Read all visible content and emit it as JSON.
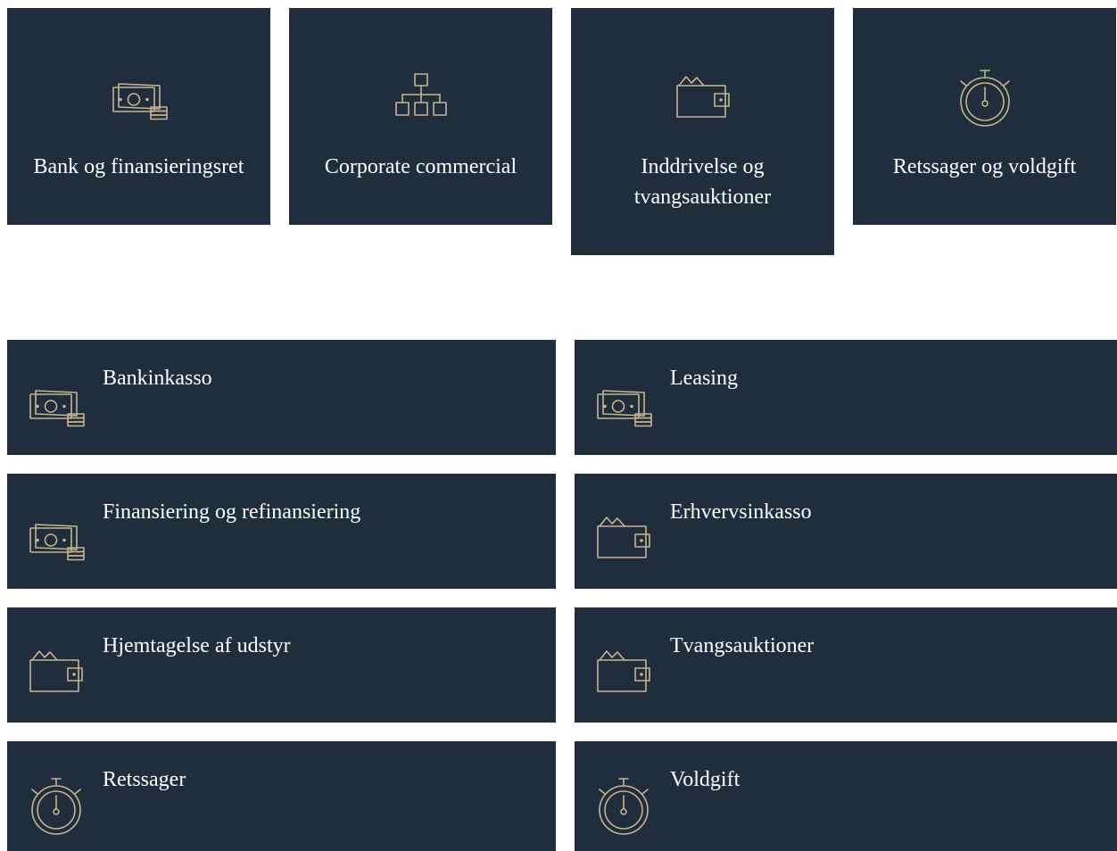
{
  "icons": {
    "color": "#c7b48e",
    "card_background": "#202d3c"
  },
  "top_cards": [
    {
      "label": "Bank og finansieringsret",
      "icon": "money-icon"
    },
    {
      "label": "Corporate commercial",
      "icon": "org-chart-icon"
    },
    {
      "label": "Inddrivelse og tvangsauktioner",
      "icon": "wallet-icon"
    },
    {
      "label": "Retssager og voldgift",
      "icon": "stopwatch-icon"
    }
  ],
  "service_list": [
    {
      "label": "Bankinkasso",
      "icon": "money-icon"
    },
    {
      "label": "Leasing",
      "icon": "money-icon"
    },
    {
      "label": "Finansiering og refinansiering",
      "icon": "money-icon"
    },
    {
      "label": "Erhvervsinkasso",
      "icon": "wallet-icon"
    },
    {
      "label": "Hjemtagelse af udstyr",
      "icon": "wallet-icon"
    },
    {
      "label": "Tvangsauktioner",
      "icon": "wallet-icon"
    },
    {
      "label": "Retssager",
      "icon": "stopwatch-icon"
    },
    {
      "label": "Voldgift",
      "icon": "stopwatch-icon"
    }
  ]
}
